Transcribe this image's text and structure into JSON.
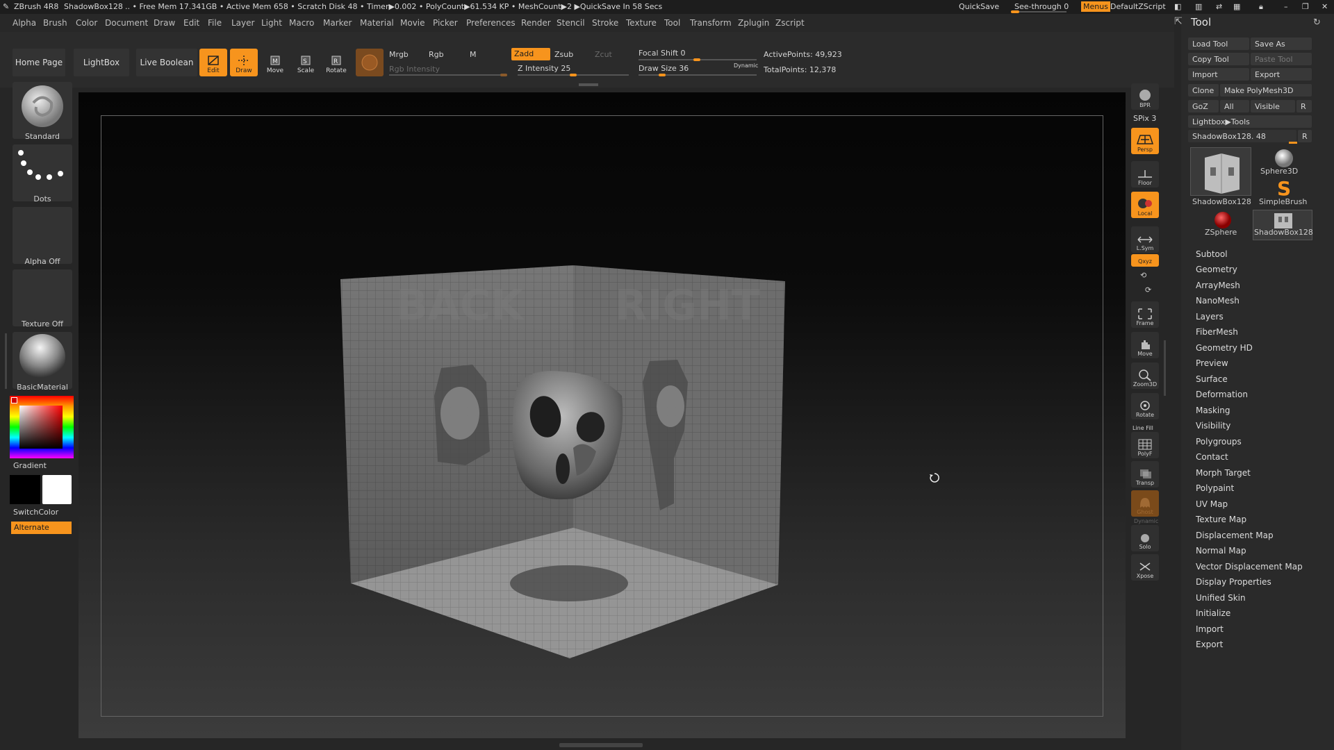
{
  "titlebar": {
    "app": "ZBrush 4R8",
    "doc": "ShadowBox128",
    "status": ".. • Free Mem 17.341GB • Active Mem 658 • Scratch Disk 48 • Timer▶0.002 • PolyCount▶61.534 KP • MeshCount▶2 ▶QuickSave In 58 Secs",
    "quicksave": "QuickSave",
    "seethrough": "See-through",
    "seethrough_value": "0",
    "menus": "Menus",
    "zscript": "DefaultZScript"
  },
  "menubar": [
    "Alpha",
    "Brush",
    "Color",
    "Document",
    "Draw",
    "Edit",
    "File",
    "Layer",
    "Light",
    "Macro",
    "Marker",
    "Material",
    "Movie",
    "Picker",
    "Preferences",
    "Render",
    "Stencil",
    "Stroke",
    "Texture",
    "Tool",
    "Transform",
    "Zplugin",
    "Zscript"
  ],
  "shelf": {
    "home": "Home Page",
    "lightbox": "LightBox",
    "liveboolean": "Live Boolean",
    "edit": "Edit",
    "draw": "Draw",
    "move": "Move",
    "scale": "Scale",
    "rotate": "Rotate",
    "mrgb": "Mrgb",
    "rgb": "Rgb",
    "m": "M",
    "rgb_intensity": "Rgb Intensity",
    "zadd": "Zadd",
    "zsub": "Zsub",
    "zcut": "Zcut",
    "z_intensity": "Z Intensity 25",
    "focal_shift": "Focal Shift 0",
    "draw_size": "Draw Size 36",
    "dynamic": "Dynamic",
    "active_points": "ActivePoints: 49,923",
    "total_points": "TotalPoints: 12,378"
  },
  "lefttray": {
    "brush": "Standard",
    "stroke": "Dots",
    "alpha": "Alpha Off",
    "texture": "Texture Off",
    "material": "BasicMaterial",
    "gradient": "Gradient",
    "switchcolor": "SwitchColor",
    "alternate": "Alternate"
  },
  "viewport": {
    "back_label": "BACK",
    "right_label": "RIGHT"
  },
  "rightshelf": {
    "bpr": "BPR",
    "spix": "SPix 3",
    "persp": "Persp",
    "floor": "Floor",
    "local": "Local",
    "lsym": "L.Sym",
    "xyz": "Qxyz",
    "frame": "Frame",
    "move": "Move",
    "zoom3d": "Zoom3D",
    "rotate": "Rotate",
    "linefill": "Line Fill",
    "polyf": "PolyF",
    "transp": "Transp",
    "ghost": "Ghost",
    "dynamic": "Dynamic",
    "solo": "Solo",
    "xpose": "Xpose"
  },
  "toolpanel": {
    "title": "Tool",
    "load_tool": "Load Tool",
    "save_as": "Save As",
    "copy_tool": "Copy Tool",
    "paste_tool": "Paste Tool",
    "import": "Import",
    "export": "Export",
    "clone": "Clone",
    "make_polymesh": "Make PolyMesh3D",
    "goz": "GoZ",
    "all": "All",
    "visible": "Visible",
    "r": "R",
    "lightbox_tools": "Lightbox▶Tools",
    "current_tool": "ShadowBox128. 48",
    "tools": [
      "ShadowBox128",
      "Sphere3D",
      "SimpleBrush",
      "ZSphere",
      "ShadowBox128"
    ],
    "sections": [
      "Subtool",
      "Geometry",
      "ArrayMesh",
      "NanoMesh",
      "Layers",
      "FiberMesh",
      "Geometry HD",
      "Preview",
      "Surface",
      "Deformation",
      "Masking",
      "Visibility",
      "Polygroups",
      "Contact",
      "Morph Target",
      "Polypaint",
      "UV Map",
      "Texture Map",
      "Displacement Map",
      "Normal Map",
      "Vector Displacement Map",
      "Display Properties",
      "Unified Skin",
      "Initialize",
      "Import",
      "Export"
    ]
  },
  "colors": {
    "accent": "#f7941d",
    "panel": "#2a2a2a",
    "background": "#262626"
  }
}
